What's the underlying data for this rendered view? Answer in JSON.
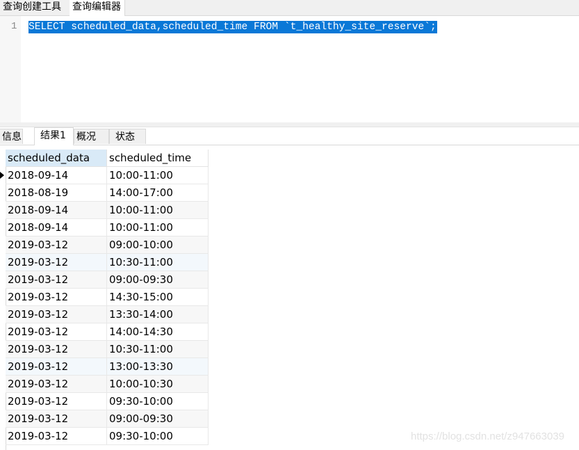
{
  "top_tabs": [
    "查询创建工具",
    "查询编辑器"
  ],
  "editor": {
    "line_number": "1",
    "sql": "SELECT scheduled_data,scheduled_time FROM `t_healthy_site_reserve`;"
  },
  "result_tabs": [
    "信息",
    "结果1",
    "概况",
    "状态"
  ],
  "active_result_tab": "结果1",
  "table": {
    "columns": [
      "scheduled_data",
      "scheduled_time"
    ],
    "rows": [
      [
        "2018-09-14",
        "10:00-11:00"
      ],
      [
        "2018-08-19",
        "14:00-17:00"
      ],
      [
        "2018-09-14",
        "10:00-11:00"
      ],
      [
        "2018-09-14",
        "10:00-11:00"
      ],
      [
        "2019-03-12",
        "09:00-10:00"
      ],
      [
        "2019-03-12",
        "10:30-11:00"
      ],
      [
        "2019-03-12",
        "09:00-09:30"
      ],
      [
        "2019-03-12",
        "14:30-15:00"
      ],
      [
        "2019-03-12",
        "13:30-14:00"
      ],
      [
        "2019-03-12",
        "14:00-14:30"
      ],
      [
        "2019-03-12",
        "10:30-11:00"
      ],
      [
        "2019-03-12",
        "13:00-13:30"
      ],
      [
        "2019-03-12",
        "10:00-10:30"
      ],
      [
        "2019-03-12",
        "09:30-10:00"
      ],
      [
        "2019-03-12",
        "09:00-09:30"
      ],
      [
        "2019-03-12",
        "09:30-10:00"
      ]
    ]
  },
  "watermark": "https://blog.csdn.net/z947663039",
  "colors": {
    "selection": "#0a78d7",
    "header_selected": "#d9eaf7"
  }
}
